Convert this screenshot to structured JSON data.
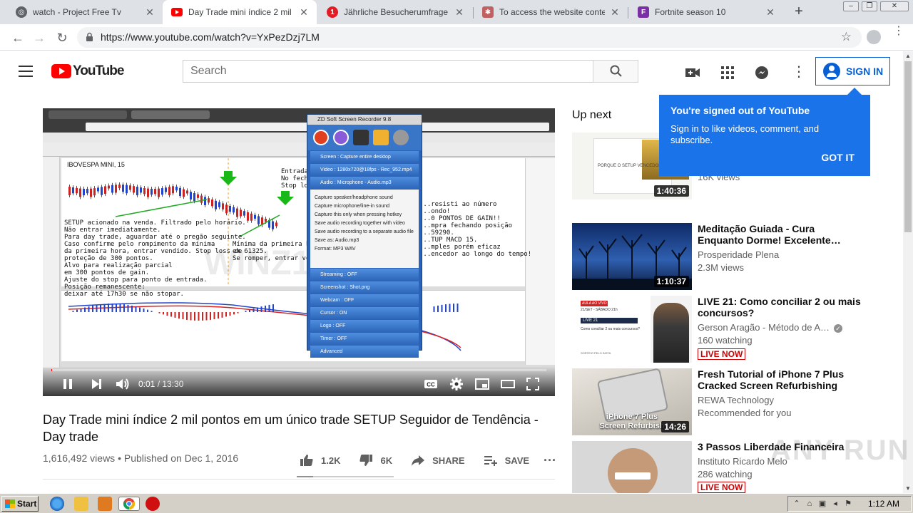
{
  "browser": {
    "tabs": [
      {
        "title": "watch - Project Free Tv",
        "active": false
      },
      {
        "title": "Day Trade mini índice 2 mil pontos",
        "active": true
      },
      {
        "title": "Jährliche Besucherumfrage 2019",
        "active": false
      },
      {
        "title": "To access the website content, p",
        "active": false
      },
      {
        "title": "Fortnite season 10",
        "active": false
      }
    ],
    "url": "https://www.youtube.com/watch?v=YxPezDzj7LM"
  },
  "masthead": {
    "logo_text": "YouTube",
    "search_placeholder": "Search",
    "signin_label": "SIGN IN"
  },
  "popup": {
    "heading": "You're signed out of YouTube",
    "body": "Sign in to like videos, comment, and subscribe.",
    "button": "GOT IT"
  },
  "player": {
    "current_time": "0:01",
    "duration": "13:30",
    "progress": 0.002,
    "frame": {
      "chart_title": "IBOVESPA MINI, 15",
      "watermark": "WINZ16",
      "note_left": "SETUP acionado na venda. Filtrado pelo horário.\nNão entrar imediatamente.\nPara day trade, aguardar até o pregão seguinte.\nCaso confirme pelo rompimento da mínima\nda primeira hora, entrar vendido. Stop loss de\nproteção de 300 pontos.\nAlvo para realização parcial\nem 300 pontos de gain.\nAjuste do stop para ponto de entrada.\nPosição remanescente:\ndeixar até 17h30 se não stopar.",
      "note_mid": "Mínima da primeira hora\nem 61325.\nSe romper, entrar vendido.",
      "note_right": "...resisti ao número\n...ondo!\n...0 PONTOS DE GAIN!!\n...mpra fechando posição\n...59290.\n...TUP MACD 15.\n...mples porém eficaz\n...encedor ao longo do tempo!",
      "note_top": "Entrada\nNo fechu\nStop los",
      "recorder": {
        "title": "ZD Soft Screen Recorder 9.8",
        "rows": [
          "Screen : Capture entire desktop",
          "Video : 1280x720@18fps - Rec_952.mp4",
          "Audio : Microphone - Audio.mp3"
        ],
        "options": [
          "Capture speaker/headphone sound",
          "Capture microphone/line-in sound",
          "Capture this only when pressing hotkey",
          "Save audio recording together with video",
          "Save audio recording to a separate audio file",
          "Save as: Audio.mp3",
          "Format: MP3   WAV"
        ],
        "rows_bottom": [
          "Streaming : OFF",
          "Screenshot : Shot.png",
          "Webcam : OFF",
          "Cursor : ON",
          "Logo : OFF",
          "Timer : OFF",
          "Advanced"
        ]
      }
    }
  },
  "video": {
    "title": "Day Trade mini índice 2 mil pontos em um único trade SETUP Seguidor de Tendência - Day trade",
    "meta": "1,616,492 views • Published on Dec 1, 2016",
    "likes": "1.2K",
    "dislikes": "6K",
    "like_ratio": 0.17,
    "share_label": "SHARE",
    "save_label": "SAVE"
  },
  "sidebar": {
    "up_next_label": "Up next",
    "items": [
      {
        "title": "",
        "channel": "",
        "views": "16K views",
        "duration": "1:40:36",
        "live": false
      },
      {
        "title": "Meditação Guiada - Cura Enquanto Dorme! Excelente…",
        "channel": "Prosperidade Plena",
        "views": "2.3M views",
        "duration": "1:10:37",
        "live": false
      },
      {
        "title": "LIVE 21: Como conciliar 2 ou mais concursos?",
        "channel": "Gerson Aragão - Método de A…",
        "views": "160 watching",
        "duration": "",
        "live": true,
        "live_label": "LIVE NOW",
        "verified": true
      },
      {
        "title": "Fresh Tutorial of iPhone 7 Plus Cracked Screen Refurbishing",
        "channel": "REWA Technology",
        "views": "Recommended for you",
        "duration": "14:26",
        "live": false,
        "thumb_text": "iPhone 7 Plus\nScreen Refurbish"
      },
      {
        "title": "3 Passos Liberdade Financeira",
        "channel": "Instituto Ricardo Melo",
        "views": "286 watching",
        "duration": "",
        "live": true,
        "live_label": "LIVE NOW"
      }
    ],
    "thumb2_texts": {
      "badge": "AULA AO VIVO",
      "sub": "21/SET - SÁBADO 21h",
      "live": "LIVE 21",
      "q": "Como conciliar 2 ou mais concursos?",
      "footer": "SORTEIO PELO INSTA"
    },
    "thumb0_text": "PORQUE O SETUP VENCEDOR PASSA..."
  },
  "taskbar": {
    "start_label": "Start",
    "clock": "1:12 AM"
  },
  "watermark_text": "ANY RUN",
  "colors": {
    "youtube_red": "#ff0000",
    "link_blue": "#065fd4",
    "popup_blue": "#1a73e8",
    "live_red": "#cc0000"
  }
}
